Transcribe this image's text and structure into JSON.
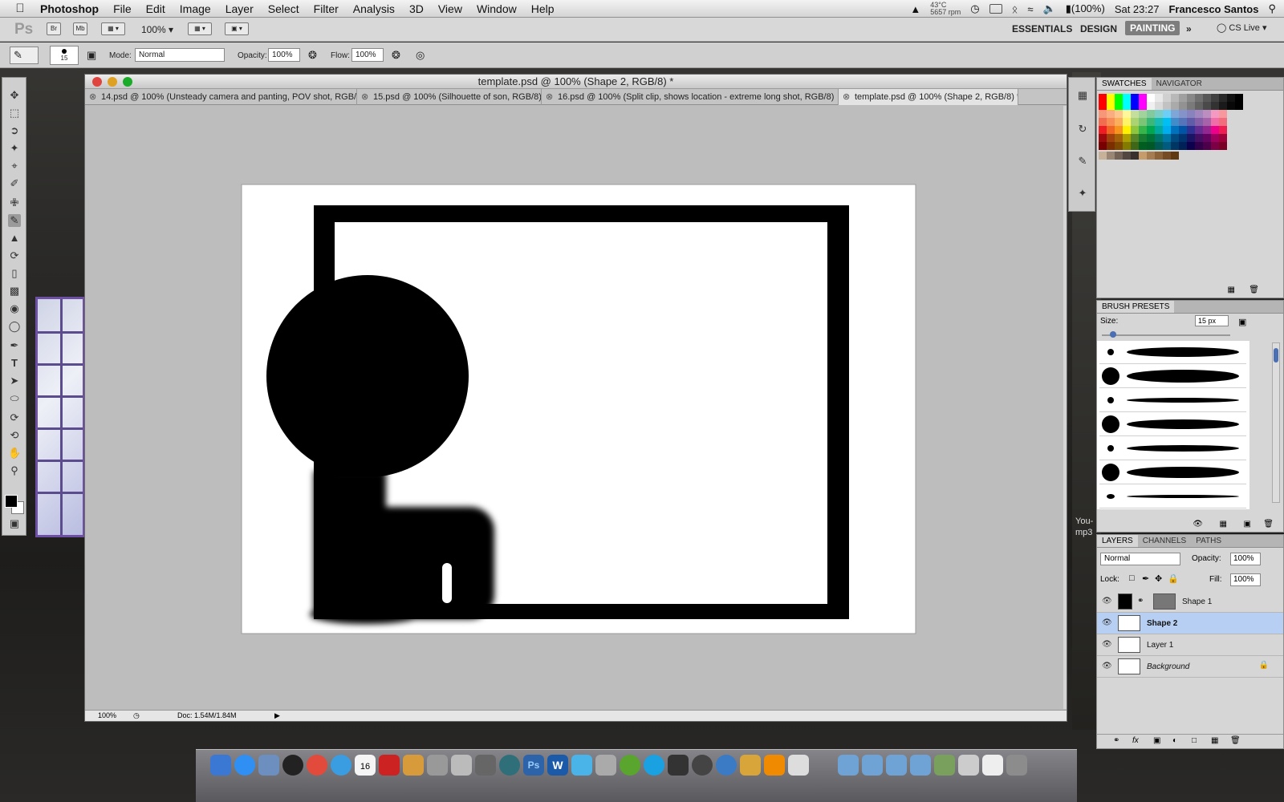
{
  "menubar": {
    "app_name": "Photoshop",
    "items": [
      "File",
      "Edit",
      "Image",
      "Layer",
      "Select",
      "Filter",
      "Analysis",
      "3D",
      "View",
      "Window",
      "Help"
    ],
    "temp": "43°C",
    "rpm": "5657 rpm",
    "battery": "(100%)",
    "clock": "Sat 23:27",
    "user": "Francesco Santos"
  },
  "appbar": {
    "logo": "Ps",
    "bridge": "Br",
    "minibridge": "Mb",
    "zoom": "100%",
    "workspaces": [
      "ESSENTIALS",
      "DESIGN",
      "PAINTING"
    ],
    "active_workspace": "PAINTING",
    "cs_live": "CS Live"
  },
  "options": {
    "brush_size": "15",
    "mode_label": "Mode:",
    "mode_value": "Normal",
    "opacity_label": "Opacity:",
    "opacity_value": "100%",
    "flow_label": "Flow:",
    "flow_value": "100%"
  },
  "document": {
    "title": "template.psd @ 100% (Shape 2, RGB/8) *",
    "tabs": [
      "14.psd @ 100% (Unsteady camera and panting, POV shot, RGB/8)",
      "15.psd @ 100% (Silhouette of son, RGB/8)",
      "16.psd @ 100% (Split clip, shows location - extreme long shot, RGB/8)",
      "template.psd @ 100% (Shape 2, RGB/8) *"
    ],
    "status_zoom": "100%",
    "status_doc": "Doc: 1.54M/1.84M"
  },
  "panels": {
    "swatches_tab": "SWATCHES",
    "navigator_tab": "NAVIGATOR",
    "brush_presets_tab": "BRUSH PRESETS",
    "size_label": "Size:",
    "size_value": "15 px",
    "layers_tab": "LAYERS",
    "channels_tab": "CHANNELS",
    "paths_tab": "PATHS",
    "blend_mode": "Normal",
    "opacity_label": "Opacity:",
    "opacity_value": "100%",
    "lock_label": "Lock:",
    "fill_label": "Fill:",
    "fill_value": "100%",
    "layers": [
      "Shape 1",
      "Shape 2",
      "Layer 1",
      "Background"
    ],
    "selected_layer": "Shape 2"
  },
  "desktop": {
    "label": "You-\nmp3"
  },
  "calendar_day": "16"
}
